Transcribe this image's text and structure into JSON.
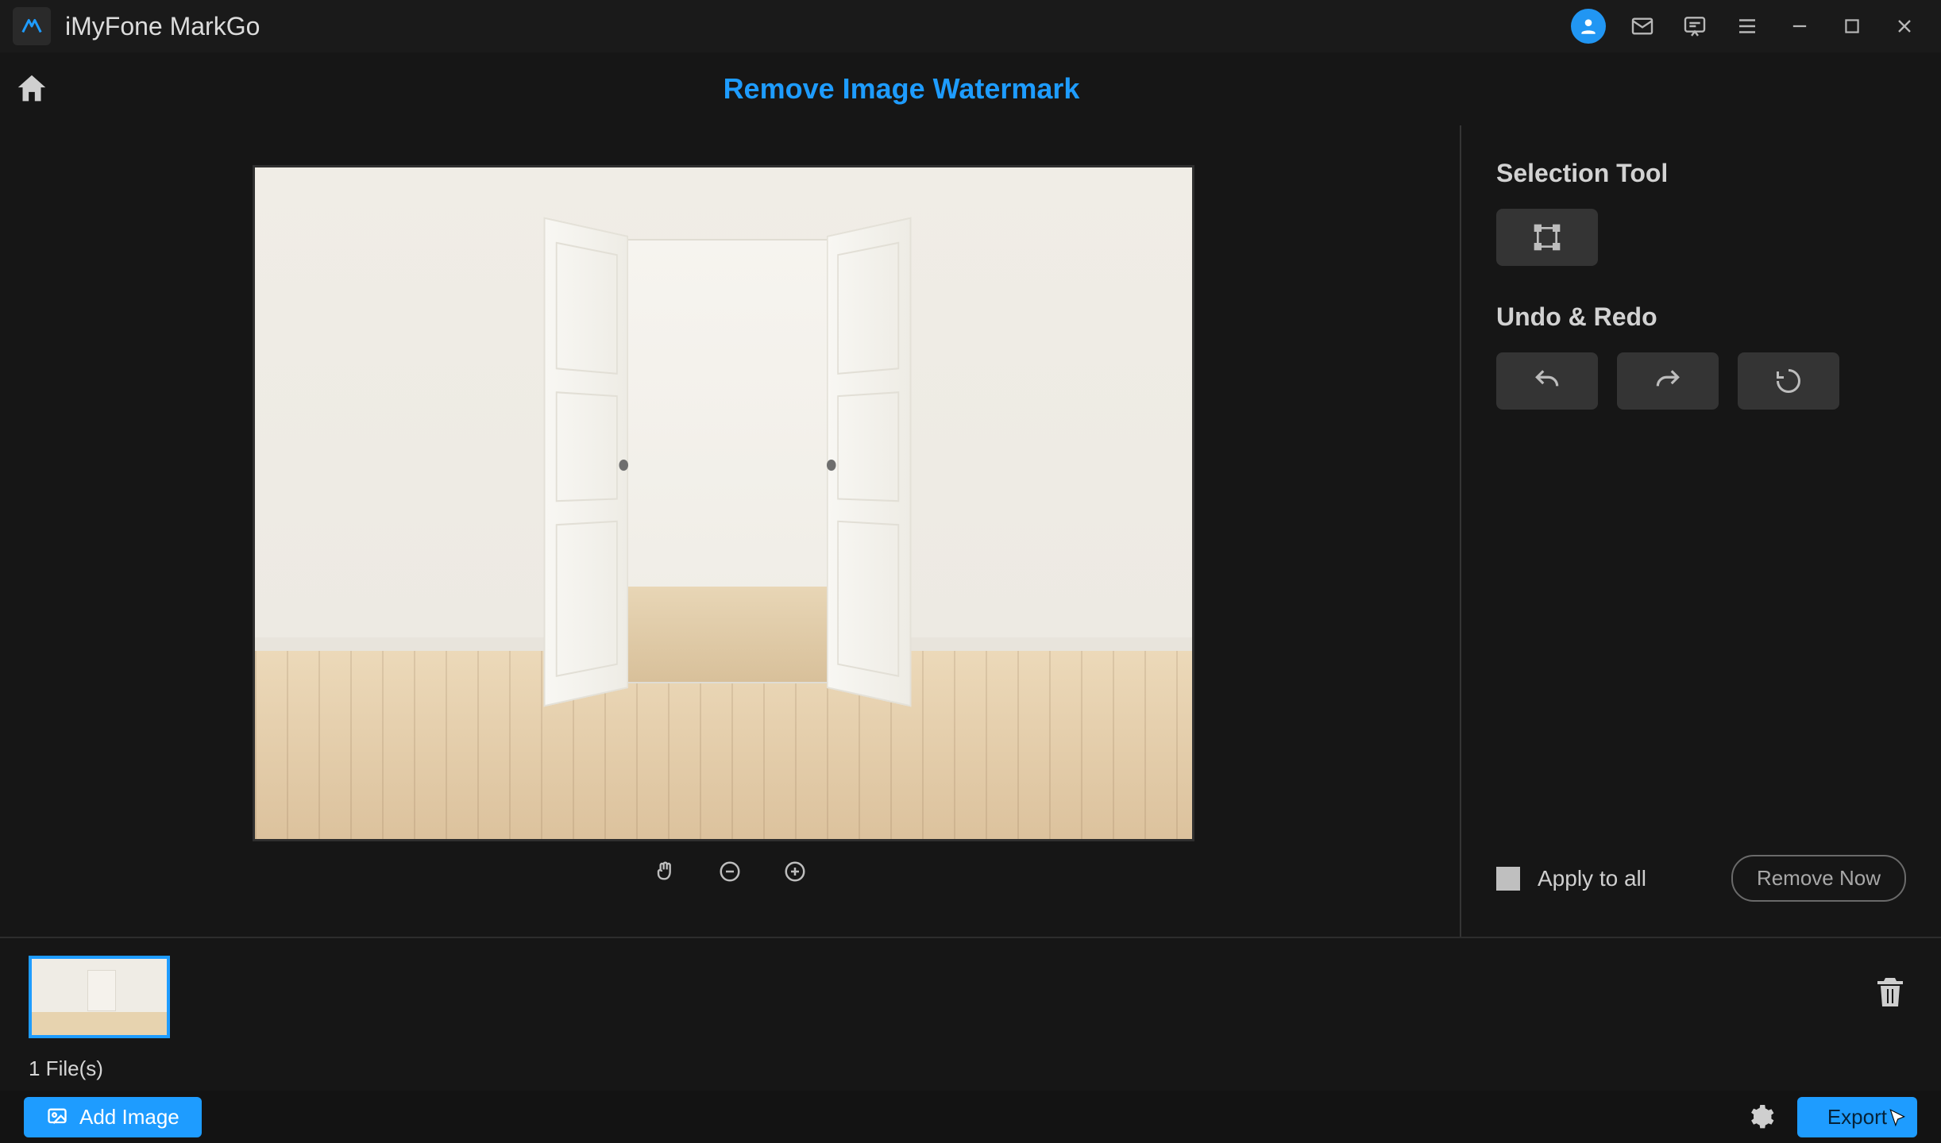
{
  "app": {
    "title": "iMyFone MarkGo"
  },
  "header": {
    "page_title": "Remove Image Watermark"
  },
  "right_panel": {
    "selection_title": "Selection Tool",
    "undo_redo_title": "Undo & Redo",
    "apply_all_label": "Apply to all",
    "remove_now_label": "Remove Now"
  },
  "footer": {
    "file_count_label": "1 File(s)"
  },
  "actionbar": {
    "add_image_label": "Add Image",
    "export_label": "Export"
  },
  "colors": {
    "accent": "#1e9cff",
    "bg": "#161616",
    "panel": "#343434"
  }
}
